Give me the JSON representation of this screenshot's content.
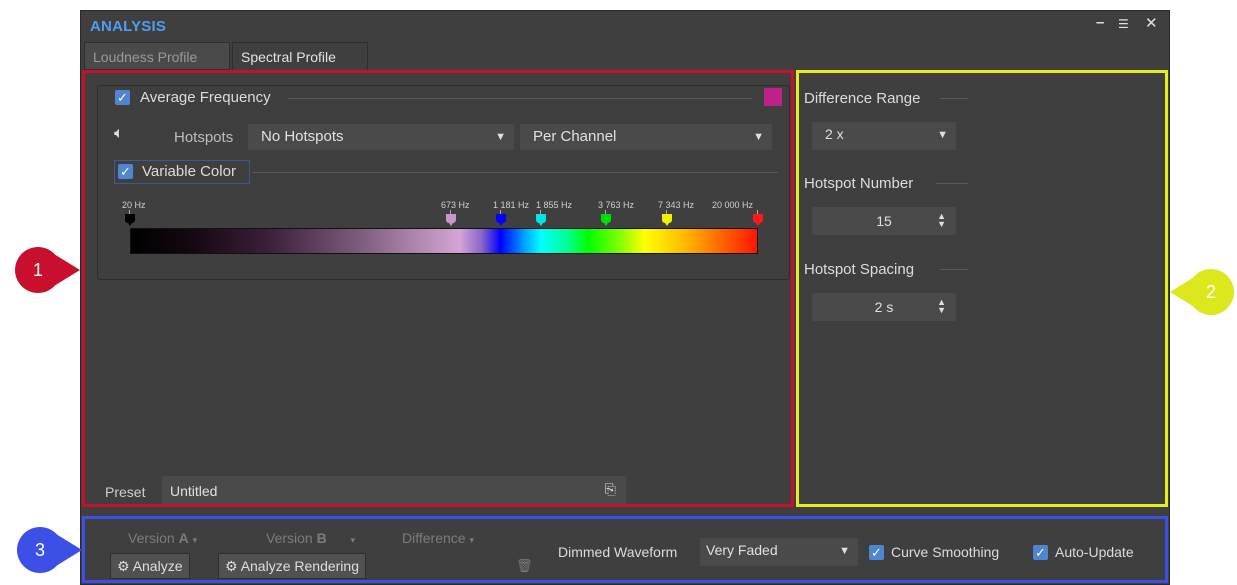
{
  "window": {
    "title": "ANALYSIS",
    "controls": {
      "minimize": "–",
      "menu": "☰",
      "close": "✕"
    }
  },
  "tabs": [
    {
      "label": "Loudness Profile",
      "active": false
    },
    {
      "label": "Spectral Profile",
      "active": true
    }
  ],
  "left_panel": {
    "average_frequency": {
      "label": "Average Frequency",
      "checked": true,
      "swatch_color": "#c0208a"
    },
    "hotspots": {
      "label": "Hotspots",
      "mode": "No Hotspots",
      "channel": "Per Channel"
    },
    "variable_color": {
      "label": "Variable Color",
      "checked": true
    },
    "frequency_markers": [
      {
        "label": "20 Hz",
        "color": "#000000"
      },
      {
        "label": "673 Hz",
        "color": "#c996c9"
      },
      {
        "label": "1 181 Hz",
        "color": "#0000ff"
      },
      {
        "label": "1 855 Hz",
        "color": "#00e5e5"
      },
      {
        "label": "3 763 Hz",
        "color": "#00dd00"
      },
      {
        "label": "7 343 Hz",
        "color": "#f0f000"
      },
      {
        "label": "20 000 Hz",
        "color": "#ff1a1a"
      }
    ],
    "preset": {
      "label": "Preset",
      "value": "Untitled"
    }
  },
  "right_panel": {
    "difference_range": {
      "label": "Difference Range",
      "value": "2 x"
    },
    "hotspot_number": {
      "label": "Hotspot Number",
      "value": "15"
    },
    "hotspot_spacing": {
      "label": "Hotspot Spacing",
      "value": "2 s"
    }
  },
  "bottom_bar": {
    "version_a": "Version",
    "version_a_letter": "A",
    "version_b": "Version",
    "version_b_letter": "B",
    "difference": "Difference",
    "analyze_label": "Analyze",
    "analyze_rendering_label": "Analyze Rendering",
    "dimmed_waveform": {
      "label": "Dimmed Waveform",
      "value": "Very Faded"
    },
    "curve_smoothing": {
      "label": "Curve Smoothing",
      "checked": true
    },
    "auto_update": {
      "label": "Auto-Update",
      "checked": true
    }
  },
  "callouts": [
    {
      "number": "1",
      "color": "#c8102e"
    },
    {
      "number": "2",
      "color": "#dde81c"
    },
    {
      "number": "3",
      "color": "#3c4fe6"
    }
  ]
}
